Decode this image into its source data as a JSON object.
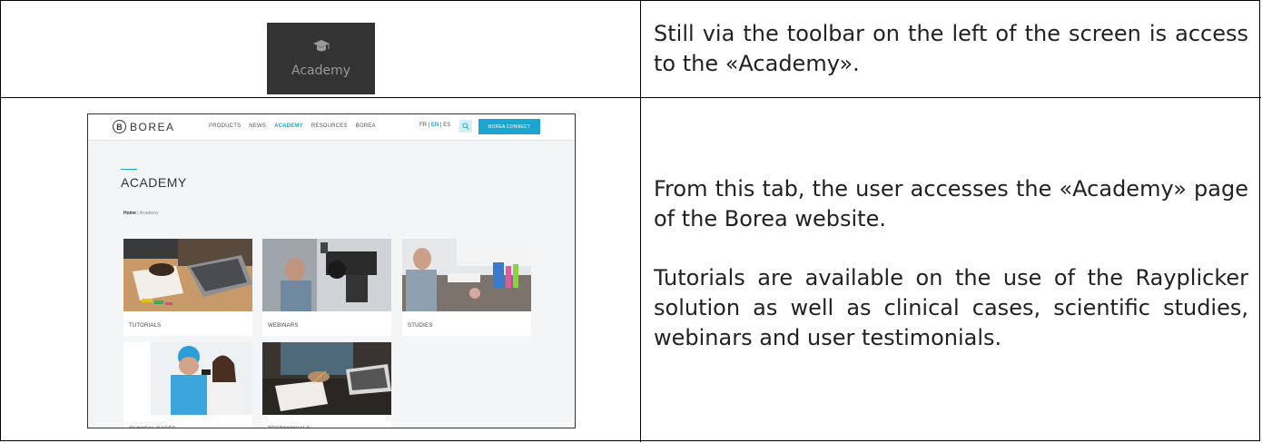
{
  "row1": {
    "toolbar_button_label": "Academy",
    "toolbar_button_icon": "graduation-cap-icon",
    "description": "Still via the toolbar on the left of the screen is access to the «Academy»."
  },
  "row2": {
    "paragraph1": "From this tab, the user accesses the «Academy» page of the Borea website.",
    "paragraph2": "Tutorials are available on the use of the Rayplicker solution as well as clinical cases, scientific studies, webinars and user testimonials."
  },
  "site": {
    "logo_letter": "B",
    "logo_text": "BOREA",
    "nav": [
      "PRODUCTS",
      "NEWS",
      "ACADEMY",
      "RESOURCES",
      "BOREA"
    ],
    "active_nav": "ACADEMY",
    "lang": [
      "FR",
      "EN",
      "ES"
    ],
    "lang_selected": "EN",
    "connect_label": "BOREA CONNECT",
    "title": "ACADEMY",
    "breadcrumb": {
      "home": "Home",
      "separator": "|",
      "current": "Academy"
    },
    "cards": [
      "TUTORIALS",
      "WEBINARS",
      "STUDIES",
      "CLINICAL CASES",
      "TESTIMONIALS"
    ],
    "colors": {
      "accent": "#1aa6d0",
      "toolbar_bg": "#333333"
    }
  }
}
